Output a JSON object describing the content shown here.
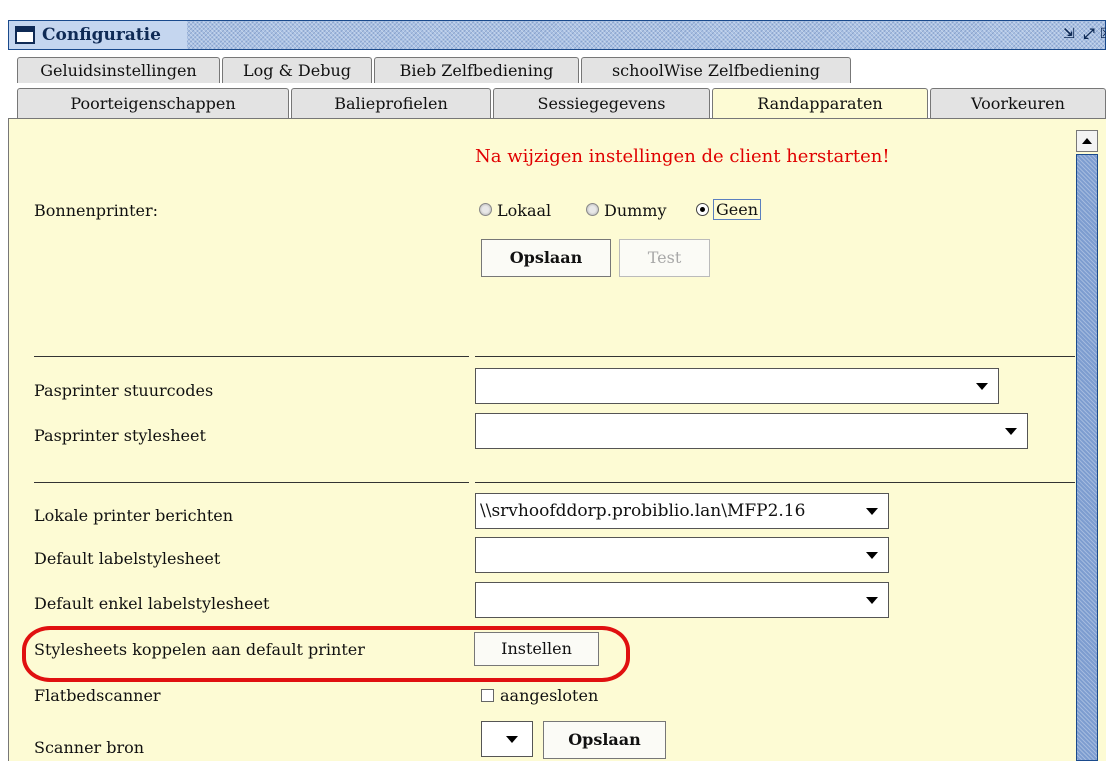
{
  "window": {
    "title": "Configuratie",
    "buttons": {
      "restore": "⇲",
      "maximize": "⤢",
      "close": "☒"
    }
  },
  "tabs_row1": [
    "Geluidsinstellingen",
    "Log & Debug",
    "Bieb Zelfbediening",
    "schoolWise Zelfbediening"
  ],
  "tabs_row2": [
    "Poorteigenschappen",
    "Balieprofielen",
    "Sessiegegevens",
    "Randapparaten",
    "Voorkeuren"
  ],
  "selected_tab": "Randapparaten",
  "warning": {
    "text": "Na wijzigen instellingen de client herstarten!",
    "color": "#e00000"
  },
  "bonnenprinter": {
    "label": "Bonnenprinter:",
    "options": [
      "Lokaal",
      "Dummy",
      "Geen"
    ],
    "selected": "Geen",
    "save_label": "Opslaan",
    "test_label": "Test"
  },
  "pasprinter": {
    "stuurcodes_label": "Pasprinter stuurcodes",
    "stuurcodes_value": "",
    "stylesheet_label": "Pasprinter stylesheet",
    "stylesheet_value": ""
  },
  "local_printer": {
    "berichten_label": "Lokale printer berichten",
    "berichten_value": "\\\\srvhoofddorp.probiblio.lan\\MFP2.16",
    "labelstylesheet_label": "Default labelstylesheet",
    "labelstylesheet_value": "",
    "enkel_label": "Default enkel labelstylesheet",
    "enkel_value": ""
  },
  "stylesheets": {
    "label": "Stylesheets koppelen aan default printer",
    "button": "Instellen",
    "highlight_color": "#e01010"
  },
  "flatbed": {
    "label": "Flatbedscanner",
    "checkbox_label": "aangesloten",
    "checked": false
  },
  "scanner": {
    "label": "Scanner bron",
    "source_value": "",
    "save_label": "Opslaan"
  }
}
